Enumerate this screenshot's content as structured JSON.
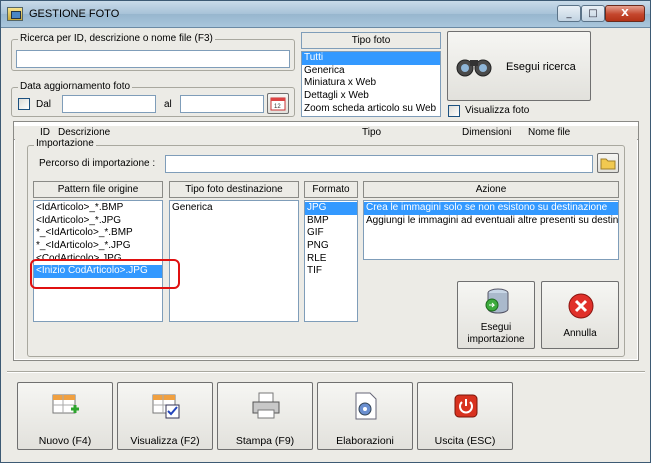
{
  "window": {
    "title": "GESTIONE FOTO",
    "min": "_",
    "max": "□",
    "close": "X"
  },
  "search": {
    "group_label": "Ricerca per ID, descrizione o nome file (F3)",
    "value": ""
  },
  "date": {
    "group_label": "Data aggiornamento foto",
    "from_label": "Dal",
    "to_label": "al",
    "from_value": "",
    "to_value": ""
  },
  "tipo_foto": {
    "header": "Tipo foto",
    "items": [
      "Tutti",
      "Generica",
      "Miniatura x Web",
      "Dettagli x Web",
      "Zoom scheda articolo su Web"
    ],
    "selected": 0
  },
  "search_button": {
    "label": "Esegui ricerca"
  },
  "show_photo": {
    "label": "Visualizza foto"
  },
  "grid_headers": [
    "ID",
    "Descrizione",
    "Tipo",
    "Dimensioni",
    "Nome file"
  ],
  "import": {
    "group_label": "Importazione",
    "path_label": "Percorso di importazione :",
    "path_value": "",
    "pattern_header": "Pattern file origine",
    "patterns": [
      "<IdArticolo>_*.BMP",
      "<IdArticolo>_*.JPG",
      "*_<IdArticolo>_*.BMP",
      "*_<IdArticolo>_*.JPG",
      "<CodArticolo>.JPG",
      "<Inizio CodArticolo>.JPG"
    ],
    "pattern_selected": 5,
    "dest_header": "Tipo foto destinazione",
    "dest_items": [
      "Generica"
    ],
    "format_header": "Formato",
    "formats": [
      "JPG",
      "BMP",
      "GIF",
      "PNG",
      "RLE",
      "TIF"
    ],
    "format_selected": 0,
    "action_header": "Azione",
    "actions": [
      "Crea le immagini solo se non esistono su destinazione",
      "Aggiungi le immagini ad eventuali altre presenti su destinazione"
    ],
    "action_selected": 0,
    "run_label_1": "Esegui",
    "run_label_2": "importazione",
    "cancel_label": "Annulla"
  },
  "toolbar": {
    "new": "Nuovo (F4)",
    "view": "Visualizza (F2)",
    "print": "Stampa (F9)",
    "process": "Elaborazioni",
    "exit": "Uscita (ESC)"
  },
  "colors": {
    "selection": "#3399ff",
    "highlight": "#e01010",
    "close": "#c4472d"
  }
}
